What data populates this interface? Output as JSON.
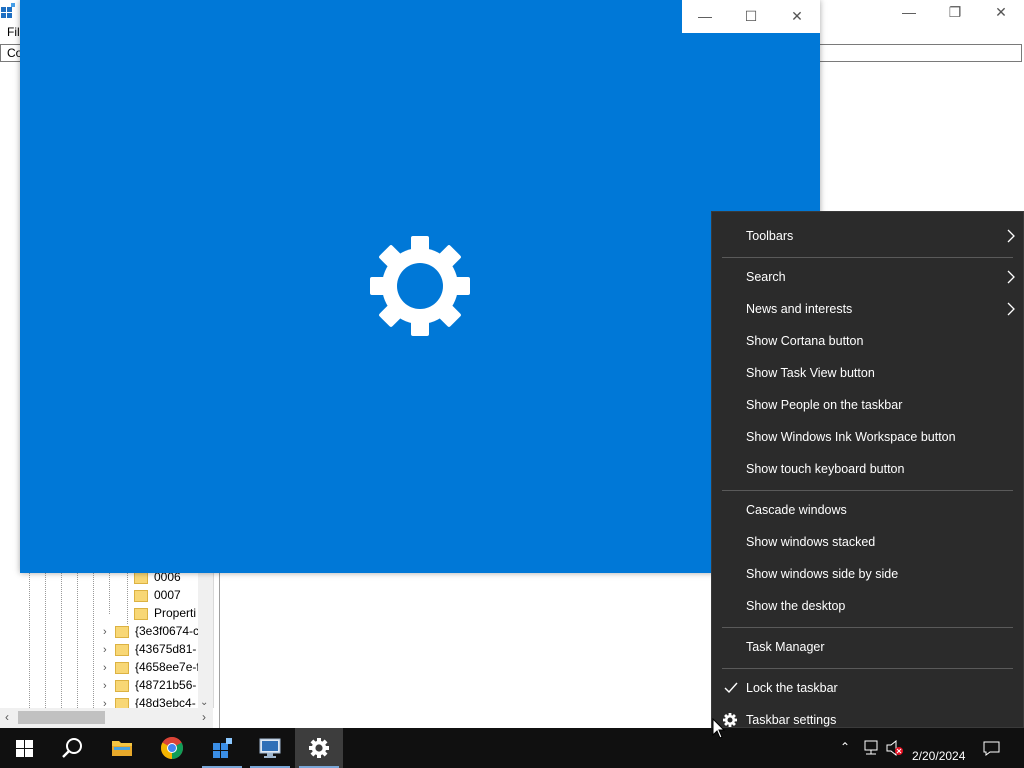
{
  "background_window": {
    "menu_fragment": "Fil",
    "address_fragment": "Co",
    "tree_items": [
      {
        "label": "0006",
        "expandable": false
      },
      {
        "label": "0007",
        "expandable": false
      },
      {
        "label": "Properti",
        "expandable": false
      },
      {
        "label": "{3e3f0674-c",
        "expandable": true
      },
      {
        "label": "{43675d81-",
        "expandable": true
      },
      {
        "label": "{4658ee7e-f",
        "expandable": true
      },
      {
        "label": "{48721b56-",
        "expandable": true
      },
      {
        "label": "{48d3ebc4-",
        "expandable": true
      }
    ]
  },
  "settings_window": {
    "background_color": "#0078d7",
    "icon": "gear-icon"
  },
  "context_menu": {
    "groups": [
      [
        {
          "label": "Toolbars",
          "submenu": true
        }
      ],
      [
        {
          "label": "Search",
          "submenu": true
        },
        {
          "label": "News and interests",
          "submenu": true
        },
        {
          "label": "Show Cortana button"
        },
        {
          "label": "Show Task View button"
        },
        {
          "label": "Show People on the taskbar"
        },
        {
          "label": "Show Windows Ink Workspace button"
        },
        {
          "label": "Show touch keyboard button"
        }
      ],
      [
        {
          "label": "Cascade windows"
        },
        {
          "label": "Show windows stacked"
        },
        {
          "label": "Show windows side by side"
        },
        {
          "label": "Show the desktop"
        }
      ],
      [
        {
          "label": "Task Manager"
        }
      ],
      [
        {
          "label": "Lock the taskbar",
          "checked": true
        },
        {
          "label": "Taskbar settings",
          "icon": "gear-icon"
        }
      ]
    ]
  },
  "taskbar": {
    "items": [
      {
        "name": "start-button",
        "icon": "windows-logo-icon"
      },
      {
        "name": "search-button",
        "icon": "search-icon"
      },
      {
        "name": "file-explorer-button",
        "icon": "folder-icon"
      },
      {
        "name": "chrome-button",
        "icon": "chrome-icon"
      },
      {
        "name": "regedit-button",
        "icon": "registry-editor-icon"
      },
      {
        "name": "remote-desktop-button",
        "icon": "computer-icon"
      },
      {
        "name": "settings-button",
        "icon": "gear-icon",
        "active": true
      }
    ],
    "date": "2/20/2024"
  }
}
